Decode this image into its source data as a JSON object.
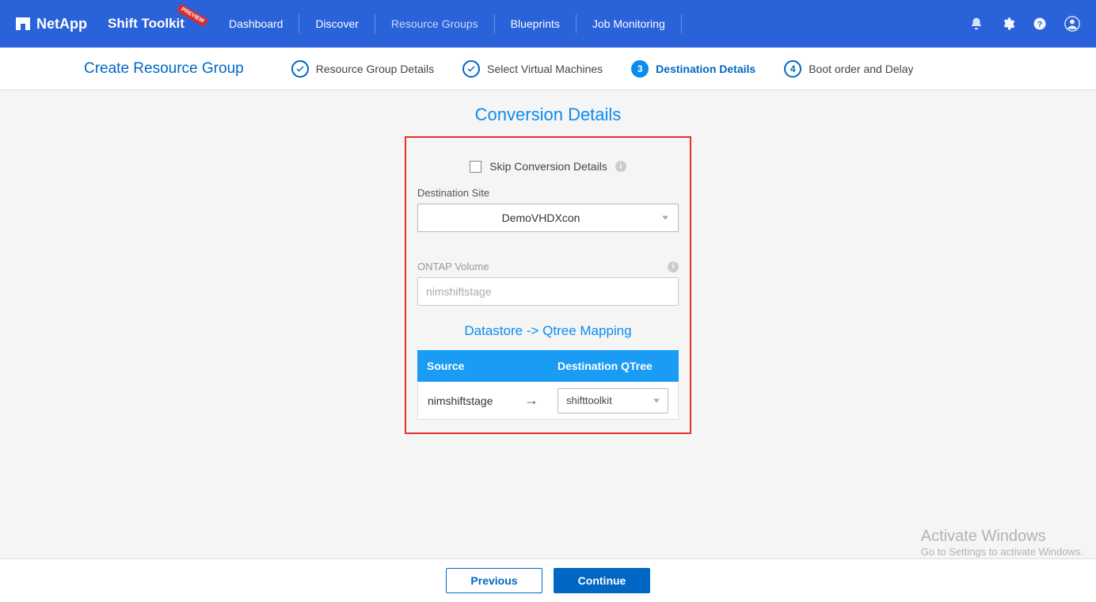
{
  "header": {
    "brand": "NetApp",
    "toolkit": "Shift Toolkit",
    "preview": "Preview",
    "nav": {
      "dashboard": "Dashboard",
      "discover": "Discover",
      "resource_groups": "Resource Groups",
      "blueprints": "Blueprints",
      "job_monitoring": "Job Monitoring"
    }
  },
  "wizard": {
    "title": "Create Resource Group",
    "steps": {
      "rg": "Resource Group Details",
      "vm": "Select Virtual Machines",
      "dest": "Destination Details",
      "boot": "Boot order and Delay",
      "boot_num": "4",
      "dest_num": "3"
    }
  },
  "form": {
    "section_title": "Conversion Details",
    "skip_label": "Skip Conversion Details",
    "dest_site_label": "Destination Site",
    "dest_site_value": "DemoVHDXcon",
    "ontap_label": "ONTAP Volume",
    "ontap_placeholder": "nimshiftstage",
    "qtree_title": "Datastore -> Qtree Mapping",
    "table": {
      "col_source": "Source",
      "col_dest": "Destination QTree",
      "row1_source": "nimshiftstage",
      "row1_dest": "shifttoolkit"
    }
  },
  "footer": {
    "previous": "Previous",
    "continue": "Continue"
  },
  "watermark": {
    "line1": "Activate Windows",
    "line2": "Go to Settings to activate Windows."
  }
}
